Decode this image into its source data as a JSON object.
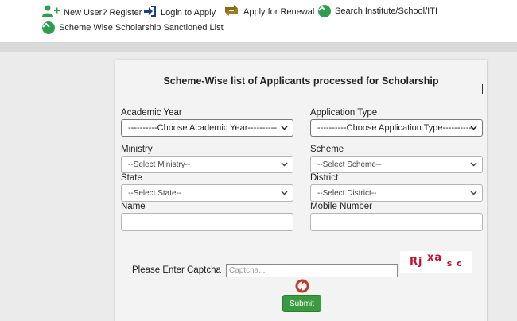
{
  "nav": {
    "new_user": "New User? Register",
    "login": "Login to Apply",
    "renewal": "Apply for Renewal",
    "search": "Search Institute/School/ITI",
    "sanctioned_list": "Scheme Wise Scholarship Sanctioned List"
  },
  "form": {
    "title": "Scheme-Wise list of Applicants processed for Scholarship",
    "academic_year": {
      "label": "Academic Year",
      "value": "----------Choose Academic Year----------"
    },
    "application_type": {
      "label": "Application Type",
      "value": "----------Choose Application Type----------"
    },
    "ministry": {
      "label": "Ministry",
      "value": "--Select Ministry--"
    },
    "scheme": {
      "label": "Scheme",
      "value": "--Select Scheme--"
    },
    "state": {
      "label": "State",
      "value": "--Select State--"
    },
    "district": {
      "label": "District",
      "value": "--Select District--"
    },
    "name": {
      "label": "Name",
      "value": ""
    },
    "mobile": {
      "label": "Mobile Number",
      "value": ""
    },
    "captcha": {
      "label": "Please Enter Captcha",
      "placeholder": "Captcha...",
      "image_text": "Rj xa s c"
    },
    "submit_label": "Submit"
  },
  "colors": {
    "accent_green": "#3a9a3f",
    "captcha_red": "#c8102e"
  }
}
